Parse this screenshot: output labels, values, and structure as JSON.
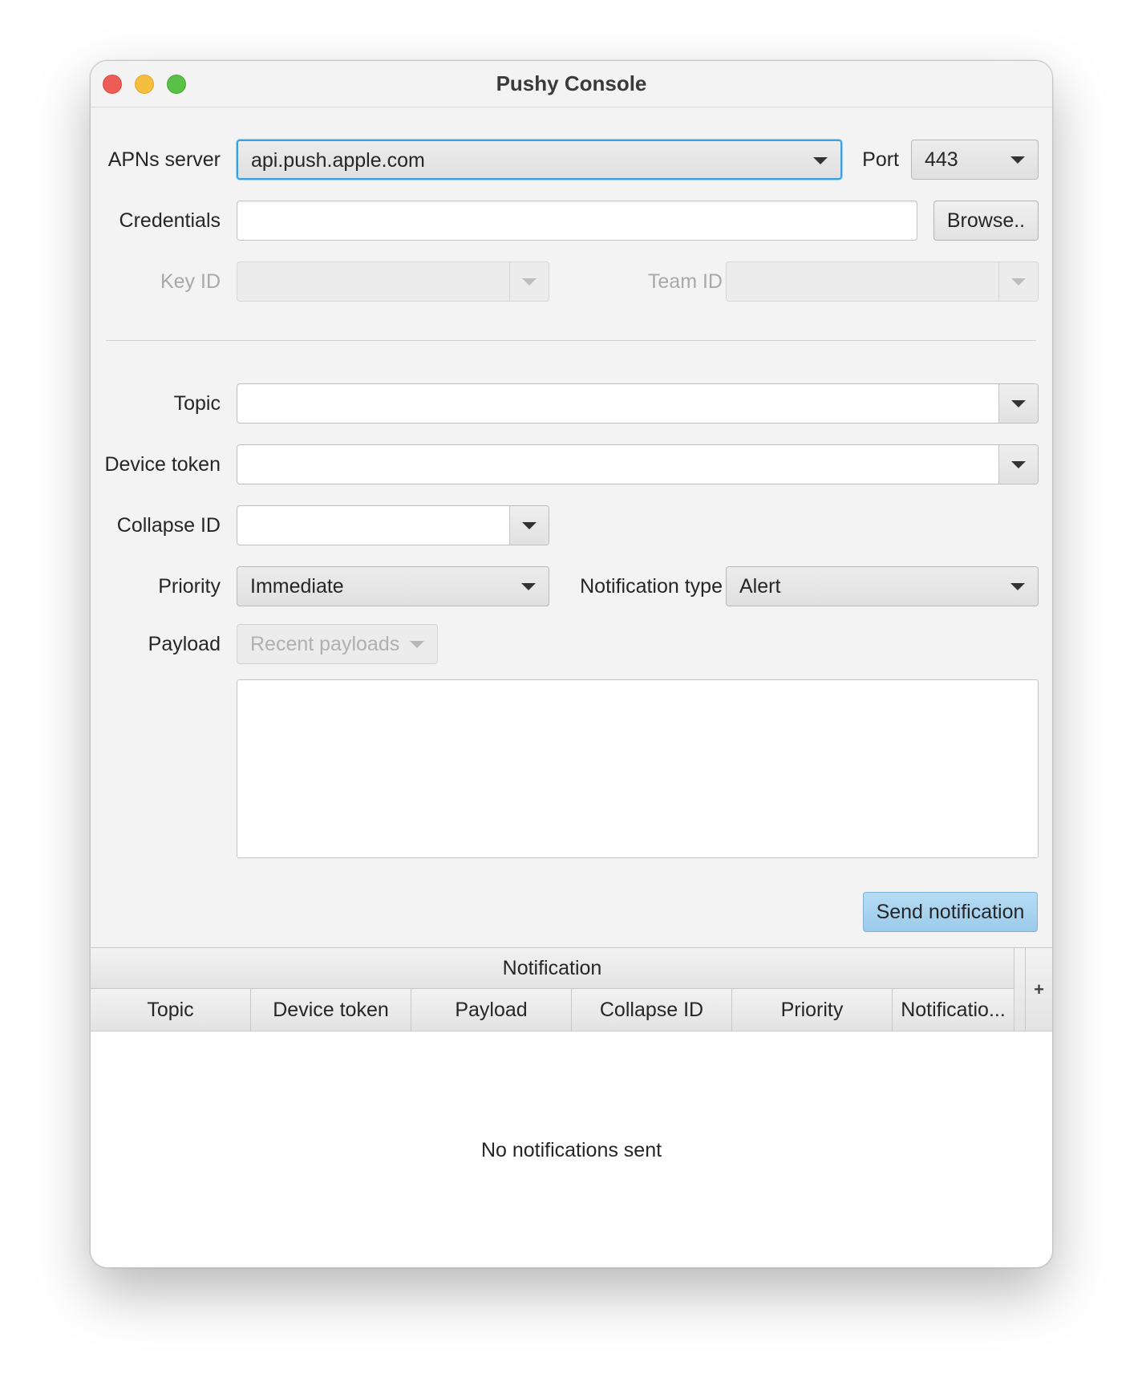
{
  "window": {
    "title": "Pushy Console"
  },
  "connection": {
    "apns_server_label": "APNs server",
    "apns_server_value": "api.push.apple.com",
    "port_label": "Port",
    "port_value": "443",
    "credentials_label": "Credentials",
    "credentials_value": "",
    "browse_label": "Browse..",
    "key_id_label": "Key ID",
    "team_id_label": "Team ID"
  },
  "notification": {
    "topic_label": "Topic",
    "device_token_label": "Device token",
    "collapse_id_label": "Collapse ID",
    "priority_label": "Priority",
    "priority_value": "Immediate",
    "notification_type_label": "Notification type",
    "notification_type_value": "Alert",
    "payload_label": "Payload",
    "recent_payloads_label": "Recent payloads",
    "payload_value": "",
    "send_label": "Send notification"
  },
  "history_table": {
    "group_header": "Notification",
    "add_column_glyph": "+",
    "columns": [
      "Topic",
      "Device token",
      "Payload",
      "Collapse ID",
      "Priority",
      "Notificatio..."
    ],
    "placeholder": "No notifications sent"
  },
  "colors": {
    "focus_ring": "#3e9fe0",
    "default_button": "#9bcbeb",
    "close": "#ee5d55",
    "minimize": "#f5be3f",
    "maximize": "#5ac148"
  }
}
